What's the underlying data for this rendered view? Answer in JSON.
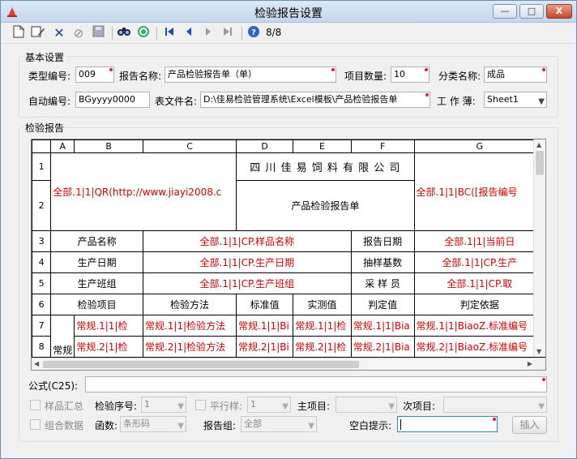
{
  "window": {
    "title": "检验报告设置",
    "controls": {
      "minimize": "—",
      "maximize": "□",
      "close": "X"
    }
  },
  "toolbar": {
    "icons": [
      "new-icon",
      "edit-icon",
      "delete-icon",
      "cancel-icon",
      "save-icon",
      "find-icon",
      "refresh-icon",
      "first-record-icon",
      "prev-record-icon",
      "next-record-icon",
      "last-record-icon",
      "help-icon"
    ],
    "record_counter": "8/8"
  },
  "basic": {
    "title": "基本设置",
    "type_code_label": "类型编号:",
    "type_code_value": "009",
    "report_name_label": "报告名称:",
    "report_name_value": "产品检验报告单（单）",
    "item_count_label": "项目数量:",
    "item_count_value": "10",
    "category_label": "分类名称:",
    "category_value": "成品",
    "auto_code_label": "自动编号:",
    "auto_code_value": "BGyyyy0000",
    "file_label": "表文件名:",
    "file_value": "D:\\佳易检验管理系统\\Excel模板\\产品检验报告单",
    "sheet_label": "工 作 薄:",
    "sheet_value": "Sheet1"
  },
  "report": {
    "title": "检验报告",
    "col_headers": [
      "A",
      "B",
      "C",
      "D",
      "E",
      "F",
      "G"
    ],
    "row_headers": [
      "1",
      "2",
      "3",
      "4",
      "5",
      "6",
      "7",
      "8"
    ],
    "r1_company": "四 川 佳 易 饲 料 有 限 公 司",
    "r12_b": "全部.1|1|QR(http://www.jiayi2008.c",
    "r12_g": "全部.1|1|BC([报告编号",
    "r2_title": "产品检验报告单",
    "r3_b": "产品名称",
    "r3_c": "全部.1|1|CP.样品名称",
    "r3_f": "报告日期",
    "r3_g": "全部.1|1|当前日",
    "r4_b": "生产日期",
    "r4_c": "全部.1|1|CP.生产日期",
    "r4_f": "抽样基数",
    "r4_g": "全部.1|1|CP.生产",
    "r5_b": "生产班组",
    "r5_c": "全部.1|1|CP.生产班组",
    "r5_f": "采 样 员",
    "r5_g": "全部.1|1|CP.取",
    "r6": [
      "检验项目",
      "检验方法",
      "标准值",
      "实测值",
      "判定值",
      "判定依据"
    ],
    "r78_a": "常规",
    "r7": [
      "常规.1|1|检",
      "常规.1|1|检验方法",
      "常规.1|1|Bi",
      "常规.1|1|检",
      "常规.1|1|Bia",
      "常规.1|1|BiaoZ.标准编号"
    ],
    "r8": [
      "常规.2|1|检",
      "常规.2|1|检验方法",
      "常规.2|1|Bi",
      "常规.2|1|检",
      "常规.2|1|Bia",
      "常规.2|1|BiaoZ.标准编号"
    ]
  },
  "bottom": {
    "formula_label": "公式(C25):",
    "formula_value": "",
    "sample_summary_label": "样品汇总",
    "check_seq_label": "检验序号:",
    "check_seq_value": "1",
    "parallel_label": "平行样:",
    "parallel_value": "1",
    "main_item_label": "主项目:",
    "main_item_value": "",
    "sub_item_label": "次项目:",
    "sub_item_value": "",
    "combined_label": "组合数据",
    "function_label": "函数:",
    "function_value": "条形码",
    "report_group_label": "报告组:",
    "report_group_value": "全部",
    "blank_hint_label": "空白提示:",
    "blank_hint_value": "",
    "insert_button": "插入"
  }
}
